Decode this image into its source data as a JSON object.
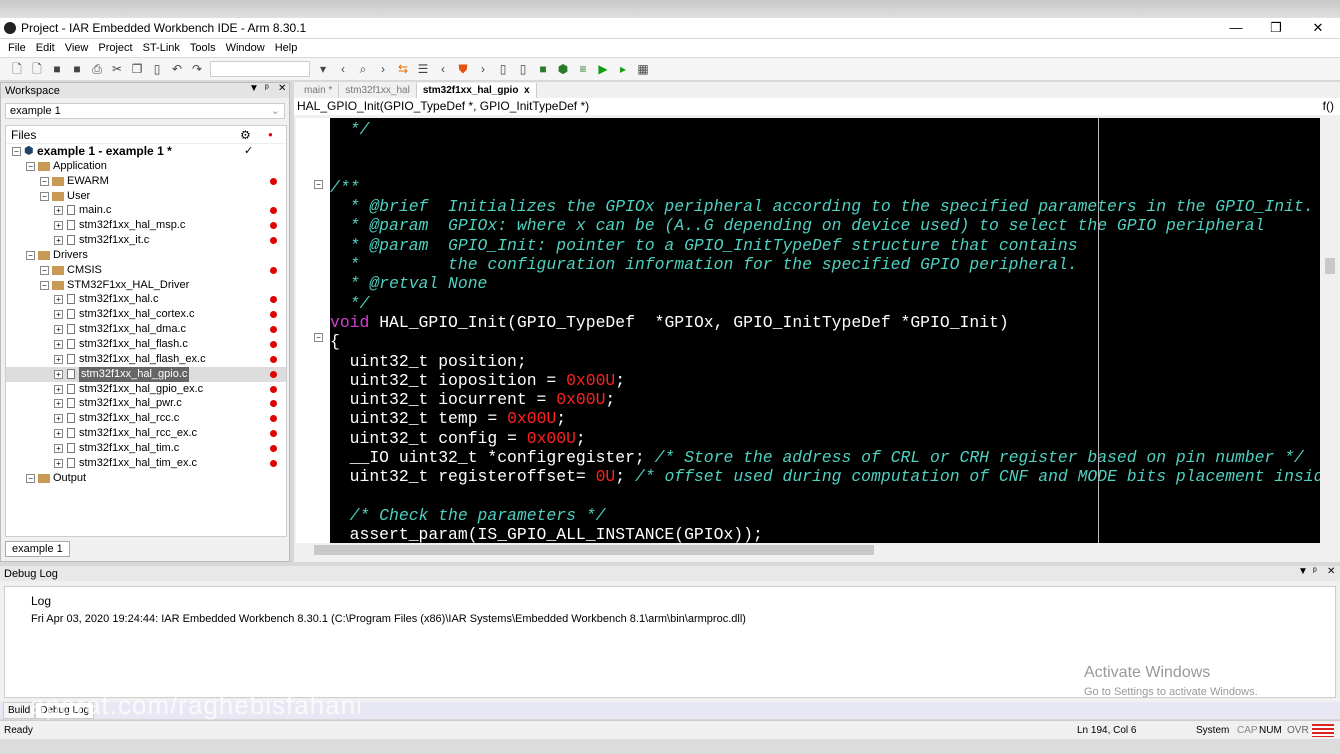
{
  "window": {
    "title": "Project - IAR Embedded Workbench IDE - Arm 8.30.1",
    "minimize": "—",
    "restore": "❐",
    "close": "✕"
  },
  "menu": [
    "File",
    "Edit",
    "View",
    "Project",
    "ST-Link",
    "Tools",
    "Window",
    "Help"
  ],
  "workspace": {
    "title": "Workspace",
    "selector": "example 1",
    "files_header": "Files",
    "bottom_tab": "example 1",
    "tree": [
      {
        "label": "example 1 - example 1 *",
        "level": 0,
        "type": "project",
        "check": "✓"
      },
      {
        "label": "Application",
        "level": 1,
        "type": "folder"
      },
      {
        "label": "EWARM",
        "level": 2,
        "type": "folder",
        "dot": true
      },
      {
        "label": "User",
        "level": 2,
        "type": "folder"
      },
      {
        "label": "main.c",
        "level": 3,
        "type": "file",
        "dot": true
      },
      {
        "label": "stm32f1xx_hal_msp.c",
        "level": 3,
        "type": "file",
        "dot": true
      },
      {
        "label": "stm32f1xx_it.c",
        "level": 3,
        "type": "file",
        "dot": true
      },
      {
        "label": "Drivers",
        "level": 1,
        "type": "folder"
      },
      {
        "label": "CMSIS",
        "level": 2,
        "type": "folder",
        "dot": true
      },
      {
        "label": "STM32F1xx_HAL_Driver",
        "level": 2,
        "type": "folder"
      },
      {
        "label": "stm32f1xx_hal.c",
        "level": 3,
        "type": "file",
        "dot": true
      },
      {
        "label": "stm32f1xx_hal_cortex.c",
        "level": 3,
        "type": "file",
        "dot": true
      },
      {
        "label": "stm32f1xx_hal_dma.c",
        "level": 3,
        "type": "file",
        "dot": true
      },
      {
        "label": "stm32f1xx_hal_flash.c",
        "level": 3,
        "type": "file",
        "dot": true
      },
      {
        "label": "stm32f1xx_hal_flash_ex.c",
        "level": 3,
        "type": "file",
        "dot": true
      },
      {
        "label": "stm32f1xx_hal_gpio.c",
        "level": 3,
        "type": "file",
        "dot": true,
        "selected": true
      },
      {
        "label": "stm32f1xx_hal_gpio_ex.c",
        "level": 3,
        "type": "file",
        "dot": true
      },
      {
        "label": "stm32f1xx_hal_pwr.c",
        "level": 3,
        "type": "file",
        "dot": true
      },
      {
        "label": "stm32f1xx_hal_rcc.c",
        "level": 3,
        "type": "file",
        "dot": true
      },
      {
        "label": "stm32f1xx_hal_rcc_ex.c",
        "level": 3,
        "type": "file",
        "dot": true
      },
      {
        "label": "stm32f1xx_hal_tim.c",
        "level": 3,
        "type": "file",
        "dot": true
      },
      {
        "label": "stm32f1xx_hal_tim_ex.c",
        "level": 3,
        "type": "file",
        "dot": true
      },
      {
        "label": "Output",
        "level": 1,
        "type": "folder"
      }
    ]
  },
  "editor": {
    "tabs": [
      "main *",
      "stm32f1xx_hal",
      "stm32f1xx_hal_gpio"
    ],
    "tab_close": "x",
    "function": "HAL_GPIO_Init(GPIO_TypeDef *, GPIO_InitTypeDef *)",
    "func_icon": "f()",
    "code": [
      [
        [
          "cm",
          "  */"
        ]
      ],
      [],
      [],
      [
        [
          "cm",
          "/**"
        ]
      ],
      [
        [
          "cm",
          "  * @brief  Initializes the GPIOx peripheral according to the specified parameters in the GPIO_Init."
        ]
      ],
      [
        [
          "cm",
          "  * @param  GPIOx: where x can be (A..G depending on device used) to select the GPIO peripheral"
        ]
      ],
      [
        [
          "cm",
          "  * @param  GPIO_Init: pointer to a GPIO_InitTypeDef structure that contains"
        ]
      ],
      [
        [
          "cm",
          "  *         the configuration information for the specified GPIO peripheral."
        ]
      ],
      [
        [
          "cm",
          "  * @retval None"
        ]
      ],
      [
        [
          "cm",
          "  */"
        ]
      ],
      [
        [
          "kw",
          "void"
        ],
        [
          "",
          "HAL_GPIO_Init(GPIO_TypeDef  *GPIOx, GPIO_InitTypeDef *GPIO_Init)"
        ]
      ],
      [
        [
          "",
          "{"
        ]
      ],
      [
        [
          "",
          "  uint32_t position;"
        ]
      ],
      [
        [
          "",
          "  uint32_t ioposition = "
        ],
        [
          "num",
          "0x00U"
        ],
        [
          "",
          ";"
        ]
      ],
      [
        [
          "",
          "  uint32_t iocurrent = "
        ],
        [
          "num",
          "0x00U"
        ],
        [
          "",
          ";"
        ]
      ],
      [
        [
          "",
          "  uint32_t temp = "
        ],
        [
          "num",
          "0x00U"
        ],
        [
          "",
          ";"
        ]
      ],
      [
        [
          "",
          "  uint32_t config = "
        ],
        [
          "num",
          "0x00U"
        ],
        [
          "",
          ";"
        ]
      ],
      [
        [
          "",
          "  __IO uint32_t *configregister; "
        ],
        [
          "cm",
          "/* Store the address of CRL or CRH register based on pin number */"
        ]
      ],
      [
        [
          "",
          "  uint32_t registeroffset= "
        ],
        [
          "num",
          "0U"
        ],
        [
          "",
          "; "
        ],
        [
          "cm",
          "/* offset used during computation of CNF and MODE bits placement inside"
        ]
      ],
      [],
      [
        [
          "cm",
          "  /* Check the parameters */"
        ]
      ],
      [
        [
          "",
          "  assert_param(IS_GPIO_ALL_INSTANCE(GPIOx));"
        ]
      ]
    ]
  },
  "debug": {
    "title": "Debug Log",
    "log_header": "Log",
    "entries": [
      "Fri Apr 03, 2020 19:24:44: IAR Embedded Workbench 8.30.1 (C:\\Program Files (x86)\\IAR Systems\\Embedded Workbench 8.1\\arm\\bin\\armproc.dll)"
    ]
  },
  "bottom_tabs": [
    "Build",
    "Debug Log"
  ],
  "watermark": "aparat.com/raghebisfahani",
  "activate": {
    "title": "Activate Windows",
    "sub": "Go to Settings to activate Windows."
  },
  "status": {
    "ready": "Ready",
    "position": "Ln 194, Col 6",
    "encoding": "System",
    "cap": "CAP",
    "num": "NUM",
    "ovr": "OVR"
  }
}
